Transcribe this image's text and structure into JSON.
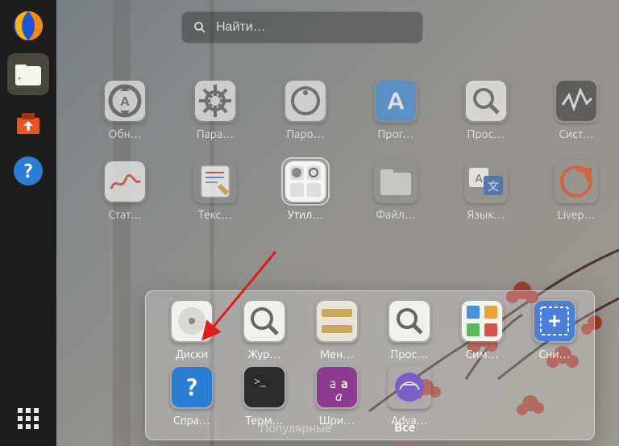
{
  "search": {
    "placeholder": "Найти…"
  },
  "dock": {
    "firefox": "Firefox",
    "files": "Файлы",
    "software": "Менеджер приложений",
    "help": "Справка",
    "apps": "Все приложения"
  },
  "tabs": {
    "frequent": "Популярные",
    "all": "Все",
    "active": "all"
  },
  "apps_row1": [
    {
      "id": "updates",
      "label": "Обн…"
    },
    {
      "id": "settings",
      "label": "Пара…"
    },
    {
      "id": "passwords",
      "label": "Паро…"
    },
    {
      "id": "software-ctr",
      "label": "Прог…"
    },
    {
      "id": "viewer",
      "label": "Прос…"
    },
    {
      "id": "sysmon",
      "label": "Сист…"
    }
  ],
  "apps_row2": [
    {
      "id": "power-stats",
      "label": "Стат…"
    },
    {
      "id": "text-editor",
      "label": "Текс…"
    },
    {
      "id": "utilities",
      "label": "Утил…",
      "selected": true
    },
    {
      "id": "file-mgr",
      "label": "Файл…"
    },
    {
      "id": "languages",
      "label": "Язык…"
    },
    {
      "id": "livepatch",
      "label": "Livep…"
    }
  ],
  "folder_apps": [
    {
      "id": "disks",
      "label": "Диски"
    },
    {
      "id": "logs",
      "label": "Жур…"
    },
    {
      "id": "ruler",
      "label": "Мен…"
    },
    {
      "id": "viewer2",
      "label": "Прос…"
    },
    {
      "id": "charmap",
      "label": "Сим…"
    },
    {
      "id": "screenshot",
      "label": "Сни…"
    },
    {
      "id": "help2",
      "label": "Спра…"
    },
    {
      "id": "terminal",
      "label": "Терм…"
    },
    {
      "id": "fonts",
      "label": "Шри…"
    },
    {
      "id": "advanced",
      "label": "Adva…"
    }
  ],
  "colors": {
    "accent": "#e95420"
  }
}
